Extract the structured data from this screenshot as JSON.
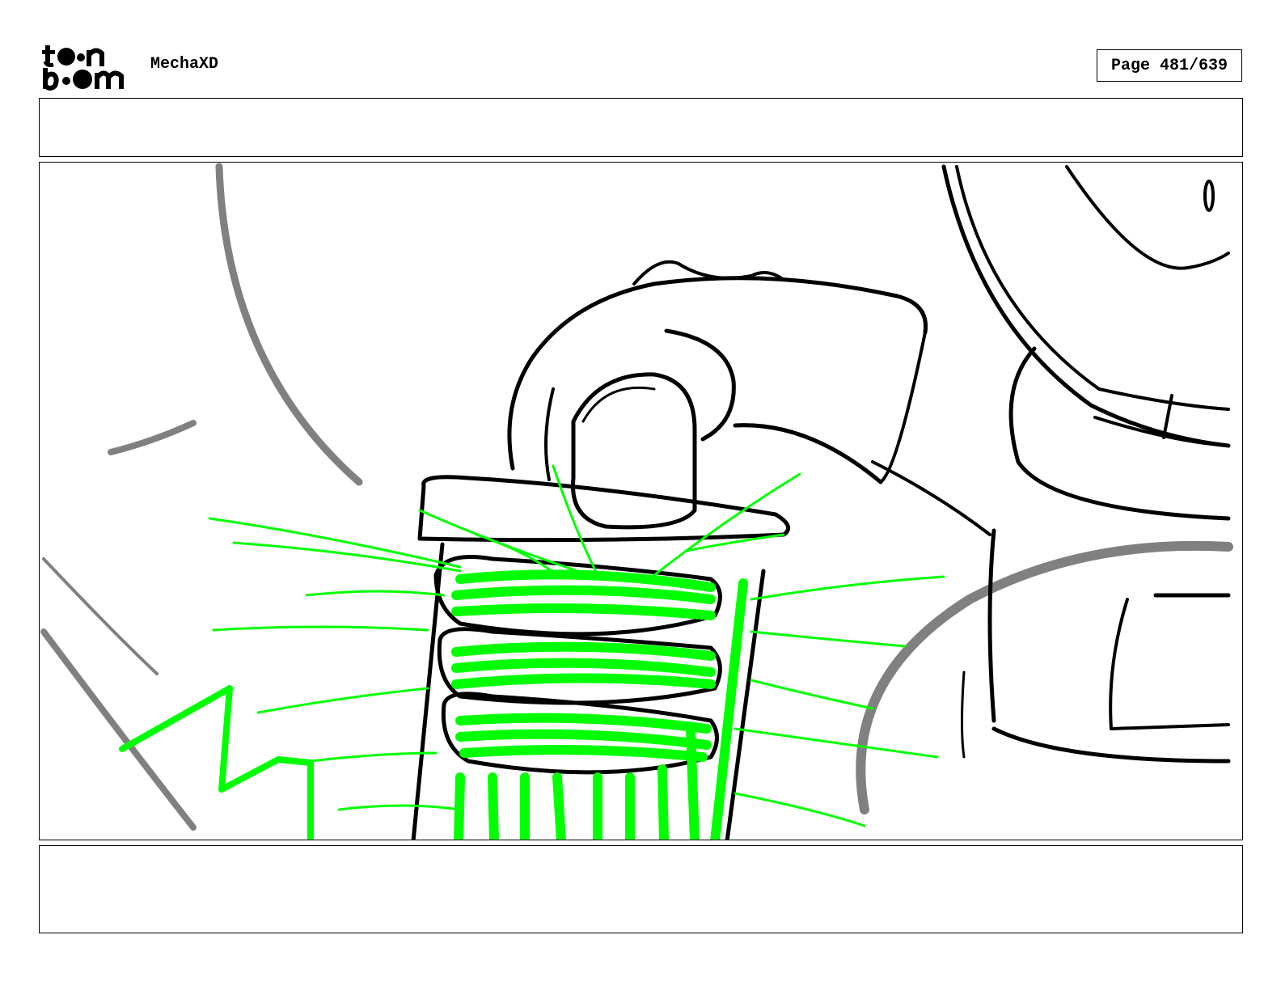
{
  "header": {
    "logo_text": "toon boom",
    "project_title": "MechaXD",
    "page_label": "Page 481/639"
  },
  "caption": {
    "text": ""
  },
  "notes": {
    "text": ""
  },
  "panel": {
    "description_icon": "storyboard-sketch",
    "colors": {
      "line": "#000000",
      "shadow": "#808080",
      "fx": "#00ff00"
    }
  }
}
